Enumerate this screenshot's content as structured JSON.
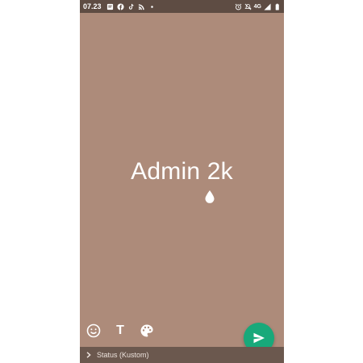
{
  "status_bar": {
    "time": "07.23",
    "network": "4G",
    "left_icons": [
      "message-icon",
      "facebook-icon",
      "tiktok-icon",
      "rss-icon",
      "dot-icon"
    ],
    "right_icons": [
      "alarm-icon",
      "mute-icon",
      "signal-icon",
      "battery-icon"
    ]
  },
  "status_text": "Admin 2k",
  "toolbar": {
    "emoji_icon": "smiley-icon",
    "text_label": "T",
    "palette_icon": "palette-icon",
    "drop_icon": "drop-icon"
  },
  "send_icon": "send-icon",
  "bottom": {
    "label": "Status (Kustom)"
  },
  "colors": {
    "background": "#ad8b7a",
    "status_bar": "#5e4c43",
    "send_button": "#18a97a",
    "bottom_bar": "#6b584e"
  }
}
